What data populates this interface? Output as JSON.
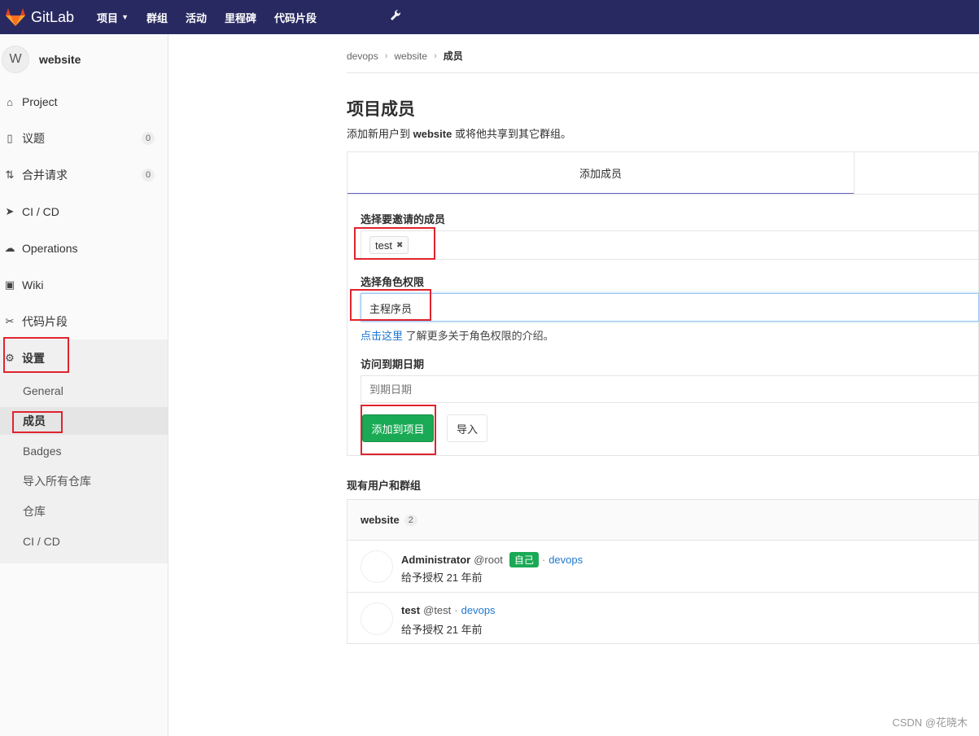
{
  "topbar": {
    "brand": "GitLab",
    "nav": [
      {
        "label": "项目",
        "has_caret": true
      },
      {
        "label": "群组"
      },
      {
        "label": "活动"
      },
      {
        "label": "里程碑"
      },
      {
        "label": "代码片段"
      }
    ],
    "brand_color": "#292961"
  },
  "sidebar": {
    "avatar_letter": "W",
    "project_name": "website",
    "items": [
      {
        "label": "Project",
        "icon": "home-icon"
      },
      {
        "label": "议题",
        "icon": "issues-icon",
        "count": "0"
      },
      {
        "label": "合并请求",
        "icon": "merge-request-icon",
        "count": "0"
      },
      {
        "label": "CI / CD",
        "icon": "rocket-icon"
      },
      {
        "label": "Operations",
        "icon": "cloud-gear-icon"
      },
      {
        "label": "Wiki",
        "icon": "book-icon"
      },
      {
        "label": "代码片段",
        "icon": "scissors-icon"
      },
      {
        "label": "设置",
        "icon": "gear-icon"
      }
    ],
    "settings_sub": [
      {
        "label": "General"
      },
      {
        "label": "成员",
        "active": true
      },
      {
        "label": "Badges"
      },
      {
        "label": "导入所有仓库"
      },
      {
        "label": "仓库"
      },
      {
        "label": "CI / CD"
      }
    ]
  },
  "breadcrumb": [
    "devops",
    "website",
    "成员"
  ],
  "main": {
    "title": "项目成员",
    "intro_prefix": "添加新用户到",
    "intro_project": "website",
    "intro_suffix": "或将他共享到其它群组。",
    "tab_add": "添加成员",
    "invite_label": "选择要邀请的成员",
    "invite_token": "test",
    "role_label": "选择角色权限",
    "role_value": "主程序员",
    "help_link": "点击这里",
    "help_text": "了解更多关于角色权限的介绍。",
    "expire_label": "访问到期日期",
    "expire_placeholder": "到期日期",
    "add_button": "添加到项目",
    "import_button": "导入",
    "existing_title": "现有用户和群组",
    "group_name": "website",
    "group_count": "2",
    "members": [
      {
        "name": "Administrator",
        "username": "@root",
        "self_badge": "自己",
        "group": "devops",
        "granted": "给予授权 21 年前"
      },
      {
        "name": "test",
        "username": "@test",
        "group": "devops",
        "granted": "给予授权 21 年前"
      }
    ]
  },
  "watermark": "CSDN @花晓木",
  "colors": {
    "accent": "#1aaa55",
    "link": "#1f78d1",
    "highlight_box": "#e0242e",
    "tab_underline": "#6666c4"
  }
}
